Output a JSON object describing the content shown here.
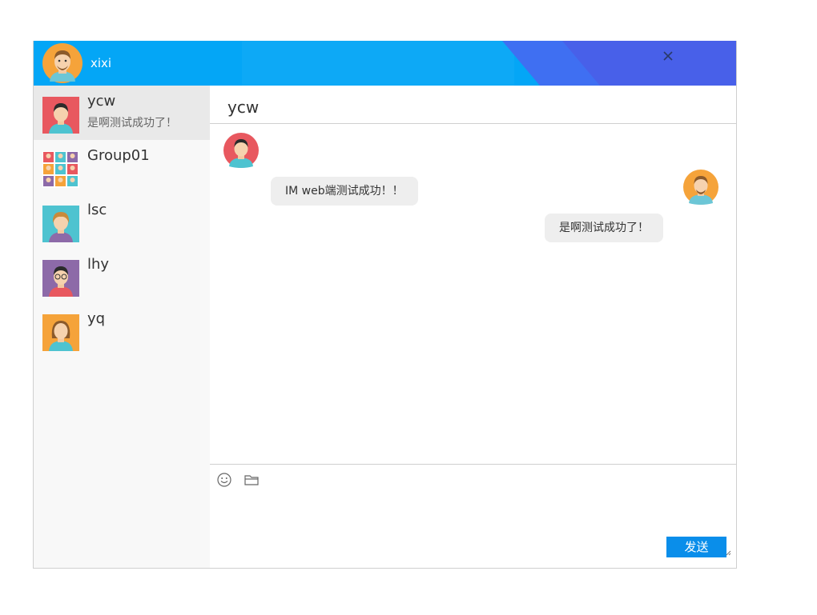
{
  "header": {
    "username": "xixi",
    "colors": {
      "bar": "#04a6f6",
      "accent": "#3f6ff2"
    },
    "icons": {
      "avatar": "male-avatar-icon",
      "close": "close-icon"
    }
  },
  "contacts": [
    {
      "name": "ycw",
      "last_message": "是啊测试成功了！",
      "avatar": "avatar-red-boy-icon",
      "active": true
    },
    {
      "name": "Group01",
      "last_message": "",
      "avatar": "group-avatar-icon",
      "active": false
    },
    {
      "name": "lsc",
      "last_message": "",
      "avatar": "avatar-teal-girl-icon",
      "active": false
    },
    {
      "name": "lhy",
      "last_message": "",
      "avatar": "avatar-purple-glasses-icon",
      "active": false
    },
    {
      "name": "yq",
      "last_message": "",
      "avatar": "avatar-orange-girl-icon",
      "active": false
    }
  ],
  "chat": {
    "title": "ycw",
    "messages": [
      {
        "from": "ycw",
        "side": "left",
        "text": "IM web端测试成功！！"
      },
      {
        "from": "xixi",
        "side": "right",
        "text": "是啊测试成功了！"
      }
    ]
  },
  "composer": {
    "send_label": "发送",
    "icons": [
      "emoji-icon",
      "folder-icon"
    ],
    "send_color": "#0a8eea"
  }
}
